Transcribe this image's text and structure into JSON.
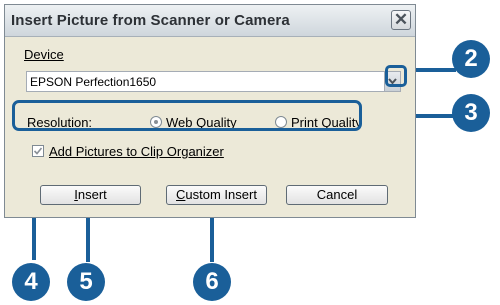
{
  "dialog": {
    "title": "Insert Picture from Scanner or Camera",
    "close_glyph": "✕"
  },
  "device": {
    "label": "Device",
    "selected": "EPSON Perfection1650"
  },
  "resolution": {
    "label": "Resolution:",
    "options": [
      {
        "label": "Web Quality",
        "selected": true
      },
      {
        "label": "Print Quality",
        "selected": false
      }
    ]
  },
  "clip_organizer": {
    "label": "Add Pictures to Clip Organizer",
    "checked": true
  },
  "buttons": {
    "insert": "Insert",
    "custom_insert": "Custom Insert",
    "cancel": "Cancel"
  },
  "callouts": [
    "2",
    "3",
    "4",
    "5",
    "6"
  ],
  "colors": {
    "callout_blue": "#1a5f99",
    "dialog_bg": "#ece9d8"
  },
  "icons": {
    "close": "close-icon",
    "dropdown": "chevron-down-icon",
    "check": "checkmark-icon"
  }
}
